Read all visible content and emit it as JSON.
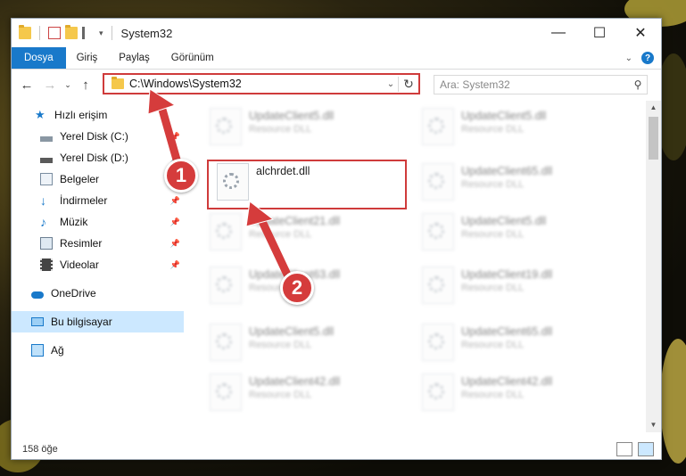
{
  "window": {
    "title": "System32",
    "controls": {
      "minimize": "—",
      "maximize": "☐",
      "close": "✕"
    }
  },
  "ribbon": {
    "tabs": [
      "Dosya",
      "Giriş",
      "Paylaş",
      "Görünüm"
    ]
  },
  "address": {
    "path": "C:\\Windows\\System32",
    "search_placeholder": "Ara: System32"
  },
  "nav": {
    "items": [
      {
        "label": "Hızlı erişim",
        "icon": "star-icon",
        "pinned": false
      },
      {
        "label": "Yerel Disk (C:)",
        "icon": "drive-icon",
        "pinned": true
      },
      {
        "label": "Yerel Disk (D:)",
        "icon": "drive-icon",
        "pinned": true
      },
      {
        "label": "Belgeler",
        "icon": "documents-icon",
        "pinned": true
      },
      {
        "label": "İndirmeler",
        "icon": "download-icon",
        "pinned": true
      },
      {
        "label": "Müzik",
        "icon": "music-icon",
        "pinned": true
      },
      {
        "label": "Resimler",
        "icon": "pictures-icon",
        "pinned": true
      },
      {
        "label": "Videolar",
        "icon": "video-icon",
        "pinned": true
      },
      {
        "label": "OneDrive",
        "icon": "cloud-icon",
        "pinned": false
      },
      {
        "label": "Bu bilgisayar",
        "icon": "computer-icon",
        "pinned": false,
        "selected": true
      },
      {
        "label": "Ağ",
        "icon": "network-icon",
        "pinned": false
      }
    ]
  },
  "files": {
    "highlighted": {
      "name": "alchrdet.dll"
    },
    "left": [
      {
        "name": "UpdateClient5.dll",
        "type": "Resource DLL"
      },
      {
        "name": "alchrdet.dll",
        "type": ""
      },
      {
        "name": "UpdateClient21.dll",
        "type": "Resource DLL"
      },
      {
        "name": "UpdateClient63.dll",
        "type": "Resource DLL"
      },
      {
        "name": "UpdateClient5.dll",
        "type": "Resource DLL"
      },
      {
        "name": "UpdateClient42.dll",
        "type": "Resource DLL"
      }
    ],
    "right": [
      {
        "name": "UpdateClient5.dll",
        "type": "Resource DLL"
      },
      {
        "name": "UpdateClient65.dll",
        "type": "Resource DLL"
      },
      {
        "name": "UpdateClient5.dll",
        "type": "Resource DLL"
      },
      {
        "name": "UpdateClient19.dll",
        "type": "Resource DLL"
      },
      {
        "name": "UpdateClient65.dll",
        "type": "Resource DLL"
      },
      {
        "name": "UpdateClient42.dll",
        "type": "Resource DLL"
      }
    ]
  },
  "status": {
    "count": "158 öğe"
  },
  "annotations": {
    "step1": "1",
    "step2": "2"
  },
  "colors": {
    "accent": "#1979ca",
    "highlight": "#cf3b3b",
    "selected_bg": "#cce8ff"
  }
}
